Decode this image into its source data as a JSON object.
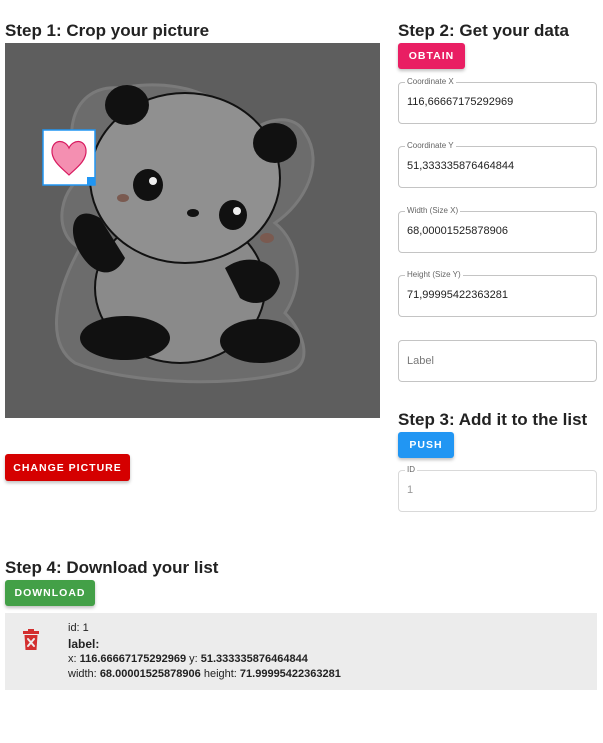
{
  "step1": {
    "title": "Step 1: Crop your picture",
    "change_button": "CHANGE PICTURE"
  },
  "step2": {
    "title": "Step 2: Get your data",
    "obtain_button": "OBTAIN",
    "fields": {
      "x": {
        "label": "Coordinate X",
        "value": "116,66667175292969"
      },
      "y": {
        "label": "Coordinate Y",
        "value": "51,333335876464844"
      },
      "w": {
        "label": "Width (Size X)",
        "value": "68,00001525878906"
      },
      "h": {
        "label": "Height (Size Y)",
        "value": "71,99995422363281"
      },
      "label": {
        "placeholder": "Label"
      }
    }
  },
  "step3": {
    "title": "Step 3: Add it to the list",
    "push_button": "PUSH",
    "id_label": "ID",
    "id_value": "1"
  },
  "step4": {
    "title": "Step 4: Download your list",
    "download_button": "DOWNLOAD",
    "item": {
      "id_text": "id: 1",
      "label_key": "label:",
      "x_key": "x:",
      "x_val": "116.66667175292969",
      "y_key": "y:",
      "y_val": "51.333335876464844",
      "w_key": "width:",
      "w_val": "68.00001525878906",
      "h_key": "height:",
      "h_val": "71.99995422363281"
    }
  },
  "colors": {
    "obtain": "#e91e63",
    "change": "#d50000",
    "push": "#2196f3",
    "download": "#43a047",
    "delete_icon": "#d32f2f"
  },
  "icons": {
    "delete": "trash-x-icon"
  }
}
